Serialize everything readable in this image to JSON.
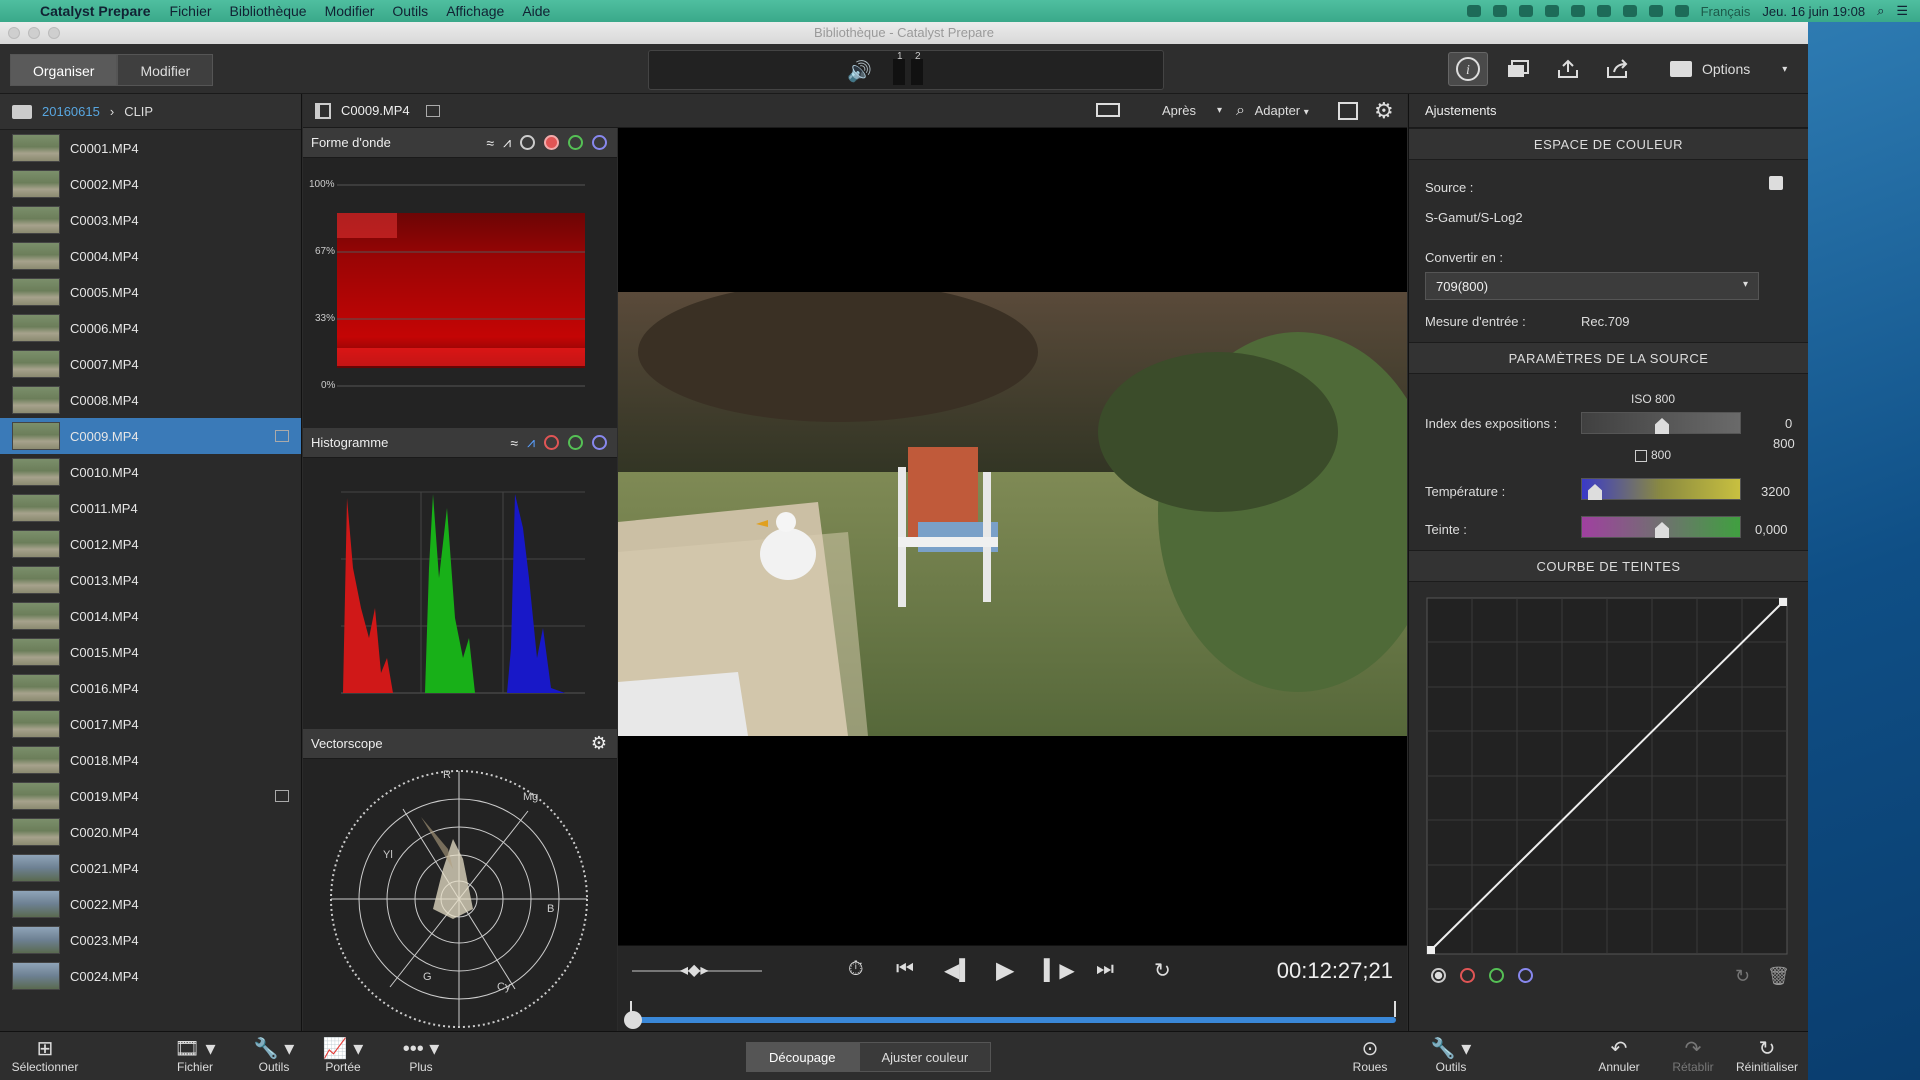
{
  "menubar": {
    "app_name": "Catalyst Prepare",
    "items": [
      "Fichier",
      "Bibliothèque",
      "Modifier",
      "Outils",
      "Affichage",
      "Aide"
    ],
    "input_source": "Français",
    "clock": "Jeu. 16 juin  19:08"
  },
  "window": {
    "title": "Bibliothèque - Catalyst Prepare"
  },
  "toolbar": {
    "modes": [
      "Organiser",
      "Modifier"
    ],
    "meter_labels": [
      "1",
      "2"
    ],
    "options_label": "Options"
  },
  "library": {
    "breadcrumb": [
      "20160615",
      "CLIP"
    ],
    "clips": [
      "C0001.MP4",
      "C0002.MP4",
      "C0003.MP4",
      "C0004.MP4",
      "C0005.MP4",
      "C0006.MP4",
      "C0007.MP4",
      "C0008.MP4",
      "C0009.MP4",
      "C0010.MP4",
      "C0011.MP4",
      "C0012.MP4",
      "C0013.MP4",
      "C0014.MP4",
      "C0015.MP4",
      "C0016.MP4",
      "C0017.MP4",
      "C0018.MP4",
      "C0019.MP4",
      "C0020.MP4",
      "C0021.MP4",
      "C0022.MP4",
      "C0023.MP4",
      "C0024.MP4"
    ],
    "selected": "C0009.MP4"
  },
  "viewer": {
    "clip_name": "C0009.MP4",
    "view_mode": "Après",
    "zoom": "Adapter",
    "timecode": "00:12:27;21"
  },
  "scopes": {
    "waveform": {
      "title": "Forme d'onde",
      "ticks": [
        "100%",
        "67%",
        "33%",
        "0%"
      ]
    },
    "histogram": {
      "title": "Histogramme"
    },
    "vectorscope": {
      "title": "Vectorscope",
      "labels": [
        "R",
        "Mg",
        "Yl",
        "B",
        "G",
        "Cy"
      ]
    }
  },
  "adjustments": {
    "header": "Ajustements",
    "color_space": {
      "title": "ESPACE DE COULEUR",
      "source_label": "Source :",
      "source_value": "S-Gamut/S-Log2",
      "convert_label": "Convertir en :",
      "convert_value": "709(800)",
      "measure_label": "Mesure d'entrée :",
      "measure_value": "Rec.709"
    },
    "source_params": {
      "title": "PARAMÈTRES DE LA SOURCE",
      "iso": "ISO 800",
      "exposure_label": "Index des expositions :",
      "exposure_value": "0",
      "exposure_value2": "800",
      "exposure_sub": "800",
      "temperature_label": "Température :",
      "temperature_value": "3200",
      "tint_label": "Teinte :",
      "tint_value": "0,000"
    },
    "curve": {
      "title": "COURBE DE TEINTES"
    }
  },
  "bottombar": {
    "select": "Sélectionner",
    "file": "Fichier",
    "tools": "Outils",
    "scope": "Portée",
    "more": "Plus",
    "tabs": [
      "Découpage",
      "Ajuster couleur"
    ],
    "wheels": "Roues",
    "tools2": "Outils",
    "undo": "Annuler",
    "redo": "Rétablir",
    "reset": "Réinitialiser"
  }
}
